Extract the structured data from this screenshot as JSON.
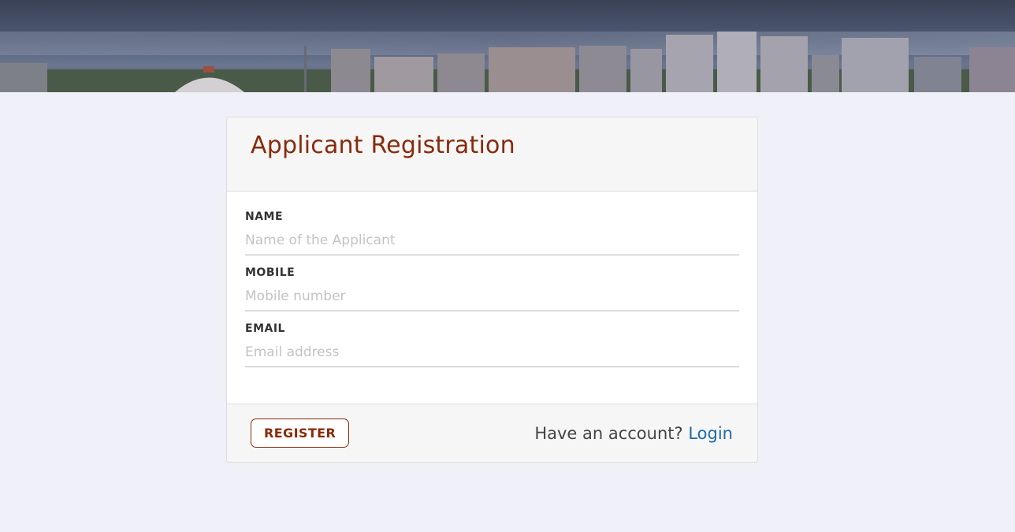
{
  "form": {
    "title": "Applicant Registration",
    "fields": [
      {
        "label": "NAME",
        "placeholder": "Name of the Applicant",
        "value": ""
      },
      {
        "label": "MOBILE",
        "placeholder": "Mobile number",
        "value": ""
      },
      {
        "label": "EMAIL",
        "placeholder": "Email address",
        "value": ""
      }
    ],
    "register_label": "REGISTER",
    "account_prompt": "Have an account?",
    "login_label": "Login"
  },
  "colors": {
    "accent": "#882a0a",
    "link": "#1d6aa8",
    "page_background": "#eff0f8"
  }
}
